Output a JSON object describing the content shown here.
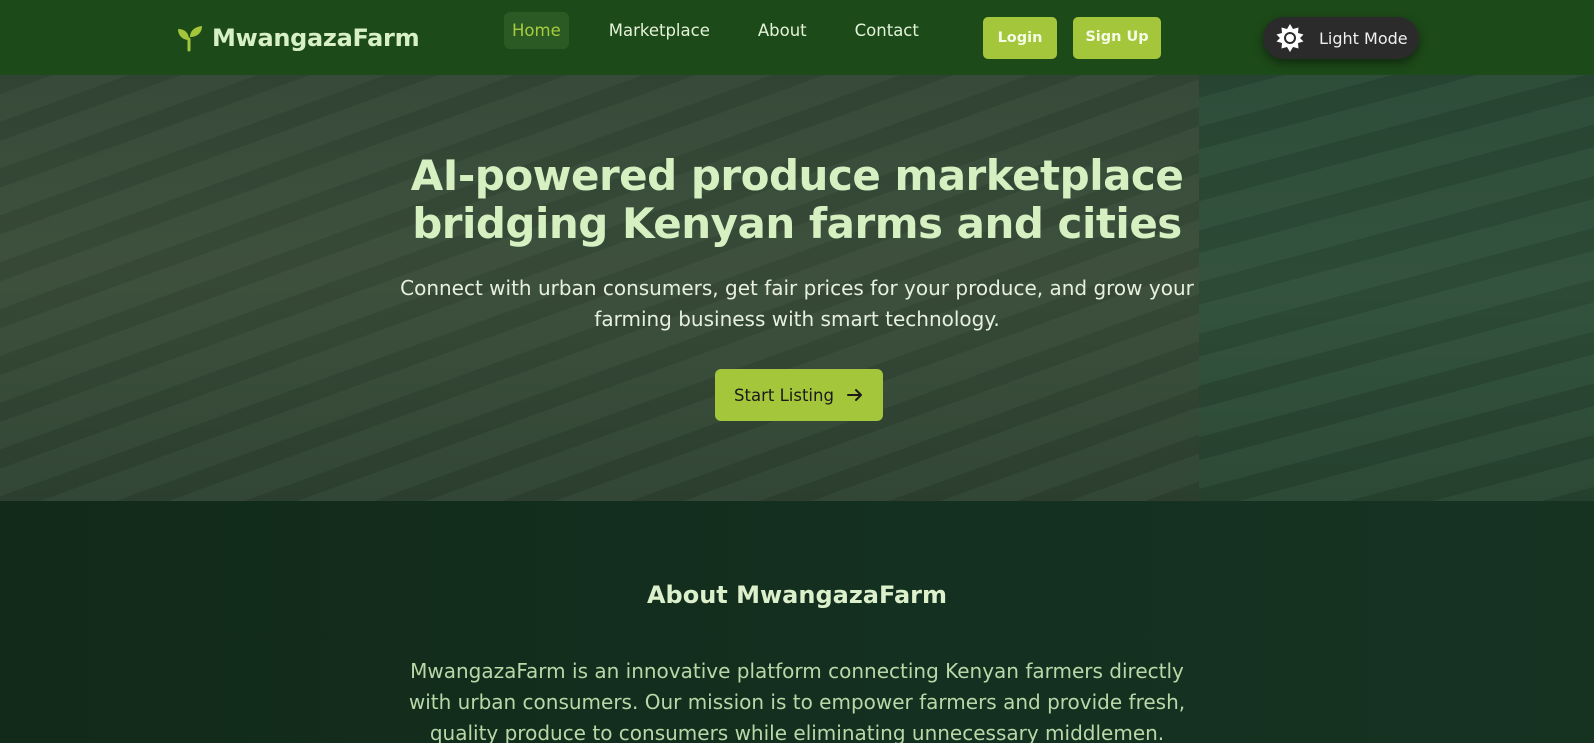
{
  "nav": {
    "brand": "MwangazaFarm",
    "links": [
      {
        "label": "Home",
        "active": true
      },
      {
        "label": "Marketplace",
        "active": false
      },
      {
        "label": "About",
        "active": false
      },
      {
        "label": "Contact",
        "active": false
      }
    ],
    "login_label": "Login",
    "signup_label": "Sign Up",
    "theme_label": "Light Mode"
  },
  "hero": {
    "title": "AI-powered produce marketplace bridging Kenyan farms and cities",
    "subtitle": "Connect with urban consumers, get fair prices for your produce, and grow your farming business with smart technology.",
    "cta_label": "Start Listing"
  },
  "about": {
    "title": "About MwangazaFarm",
    "text": "MwangazaFarm is an innovative platform connecting Kenyan farmers directly with urban consumers. Our mission is to empower farmers and provide fresh, quality produce to consumers while eliminating unnecessary middlemen."
  },
  "icons": {
    "brand": "sprout-icon",
    "theme": "sun-icon",
    "cta": "arrow-right-icon"
  },
  "colors": {
    "nav_bg": "#1d4a19",
    "accent": "#a4c63a",
    "heading": "#d6f0c2",
    "about_bg": "#142e1c"
  }
}
